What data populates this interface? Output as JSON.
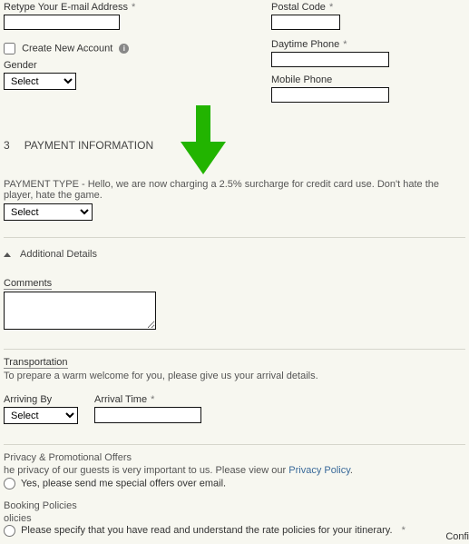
{
  "left": {
    "retype_email_label": "Retype Your E-mail Address",
    "create_account_label": "Create New Account",
    "gender_label": "Gender",
    "gender_select": "Select"
  },
  "right": {
    "postal_label": "Postal Code",
    "day_phone_label": "Daytime Phone",
    "mobile_label": "Mobile Phone"
  },
  "section3": {
    "num": "3",
    "title": "PAYMENT INFORMATION",
    "payment_note": "PAYMENT TYPE - Hello, we are now charging a 2.5% surcharge for credit card use. Don't hate the player, hate the game.",
    "payment_select": "Select"
  },
  "additional": {
    "title": "Additional Details",
    "comments_label": "Comments"
  },
  "transport": {
    "title": "Transportation",
    "subtext": "To prepare a warm welcome for you, please give us your arrival details.",
    "arriving_by_label": "Arriving By",
    "arriving_by_select": "Select",
    "arrival_time_label": "Arrival Time"
  },
  "privacy": {
    "title": "Privacy & Promotional Offers",
    "text_a": "he privacy of our guests is very important to us. Please view our ",
    "link": "Privacy Policy",
    "text_b": ".",
    "opt_label": "Yes, please send me special offers over email."
  },
  "booking": {
    "title": "Booking Policies",
    "sub": "olicies",
    "specify": "Please specify that you have read and understand the rate policies for your itinerary."
  },
  "corner": "Confi",
  "req": "*",
  "info_i": "i"
}
